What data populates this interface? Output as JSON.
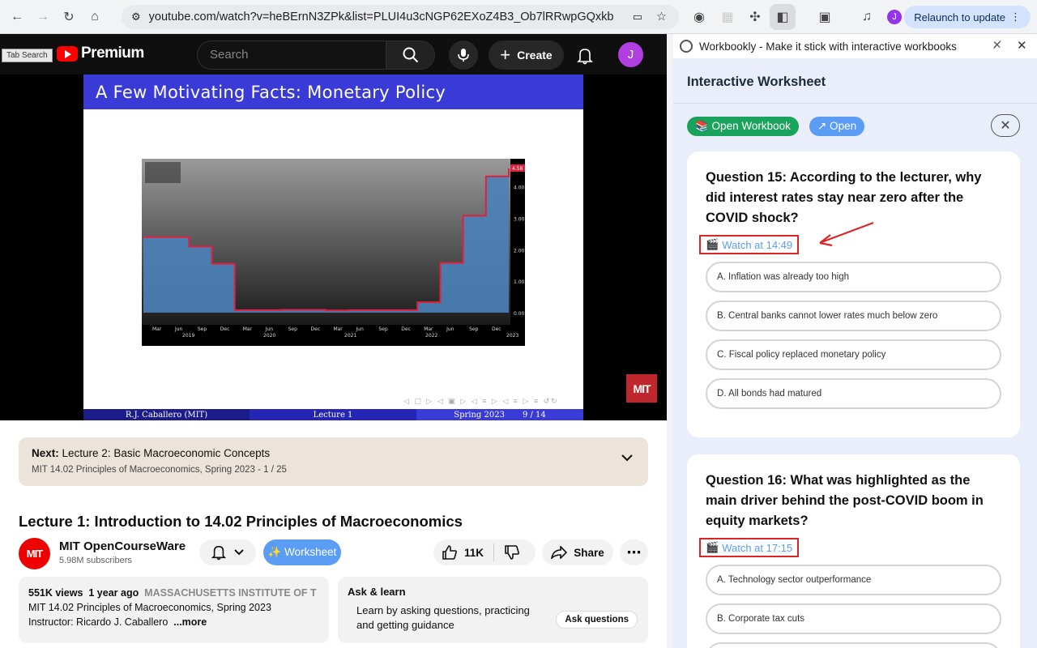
{
  "browser": {
    "url": "youtube.com/watch?v=heBErnN3ZPk&list=PLUI4u3cNGP62EXoZ4B3_Ob7lRRwpGQxkb",
    "relaunch_label": "Relaunch to update",
    "profile_initial": "J"
  },
  "youtube": {
    "tab_search_label": "Tab Search",
    "brand": "Premium",
    "search_placeholder": "Search",
    "create_label": "Create",
    "avatar_initial": "J",
    "slide": {
      "title": "A Few Motivating Facts: Monetary Policy",
      "footer_author": "R.J. Caballero  (MIT)",
      "footer_lecture": "Lecture 1",
      "footer_term": "Spring 2023",
      "footer_page": "9 / 14"
    },
    "mit_badge": "MIT",
    "next": {
      "prefix": "Next:",
      "title": "Lecture 2: Basic Macroeconomic Concepts",
      "playlist": "MIT 14.02 Principles of Macroeconomics, Spring 2023 - 1 / 25"
    },
    "video_title": "Lecture 1: Introduction to 14.02 Principles of Macroeconomics",
    "channel": {
      "logo": "MIT",
      "name": "MIT OpenCourseWare",
      "subscribers": "5.98M subscribers"
    },
    "worksheet_label": "✨ Worksheet",
    "likes": "11K",
    "share_label": "Share",
    "description": {
      "views": "551K views",
      "age": "1 year ago",
      "institution": "MASSACHUSETTS INSTITUTE OF T",
      "line2": "MIT 14.02 Principles of Macroeconomics, Spring 2023",
      "line3": "Instructor: Ricardo J. Caballero",
      "more": "...more"
    },
    "ask": {
      "heading": "Ask & learn",
      "text": "Learn by asking questions, practicing and getting guidance",
      "button": "Ask questions"
    }
  },
  "panel": {
    "header_title": "Workbookly - Make it stick with interactive workbooks",
    "worksheet_title": "Interactive Worksheet",
    "open_workbook_label": "📚 Open Workbook",
    "open_label": "↗ Open",
    "questions": [
      {
        "text": "Question 15: According to the lecturer, why did interest rates stay near zero after the COVID shock?",
        "watch": "Watch at 14:49",
        "options": [
          "A. Inflation was already too high",
          "B. Central banks cannot lower rates much below zero",
          "C. Fiscal policy replaced monetary policy",
          "D. All bonds had matured"
        ]
      },
      {
        "text": "Question 16: What was highlighted as the main driver behind the post-COVID boom in equity markets?",
        "watch": "Watch at 17:15",
        "options": [
          "A. Technology sector outperformance",
          "B. Corporate tax cuts"
        ]
      }
    ]
  },
  "chart_data": {
    "type": "area",
    "x": [
      "2019-03",
      "2019-06",
      "2019-09",
      "2019-12",
      "2020-03",
      "2020-06",
      "2020-09",
      "2020-12",
      "2021-03",
      "2021-06",
      "2021-09",
      "2021-12",
      "2022-03",
      "2022-06",
      "2022-09",
      "2022-12",
      "2023-02"
    ],
    "values": [
      2.4,
      2.4,
      2.1,
      1.55,
      0.08,
      0.08,
      0.09,
      0.09,
      0.07,
      0.08,
      0.08,
      0.08,
      0.33,
      1.58,
      3.08,
      4.33,
      4.58
    ],
    "ylim": [
      0,
      4.58
    ],
    "y_ticks": [
      "0.00",
      "1.00",
      "2.00",
      "3.00",
      "4.00"
    ],
    "last_value_label": "4.58",
    "x_month_labels": [
      "Mar",
      "Jun",
      "Sep",
      "Dec",
      "Mar",
      "Jun",
      "Sep",
      "Dec",
      "Mar",
      "Jun",
      "Sep",
      "Dec",
      "Mar",
      "Jun",
      "Sep",
      "Dec"
    ],
    "x_year_labels": [
      "2019",
      "2020",
      "2021",
      "2022",
      "2023"
    ],
    "colors": {
      "line": "#e0203c",
      "fill": "#4a82b8"
    }
  }
}
